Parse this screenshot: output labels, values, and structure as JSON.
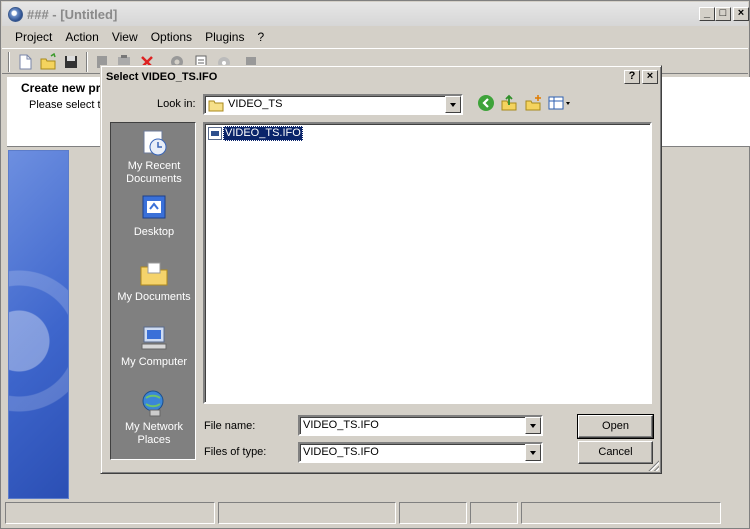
{
  "window": {
    "title": "### - [Untitled]",
    "controls": [
      "_",
      "□",
      "×"
    ]
  },
  "menu": [
    "Project",
    "Action",
    "View",
    "Options",
    "Plugins",
    "?"
  ],
  "header": {
    "title": "Create new pr",
    "subtitle": "Please select t"
  },
  "dialog": {
    "title": "Select VIDEO_TS.IFO",
    "help_label": "?",
    "close_label": "×",
    "look_in_label": "Look in:",
    "look_in_value": "VIDEO_TS",
    "places": [
      {
        "label": "My Recent Documents",
        "icon": "recent-documents-icon"
      },
      {
        "label": "Desktop",
        "icon": "desktop-icon"
      },
      {
        "label": "My Documents",
        "icon": "my-documents-icon"
      },
      {
        "label": "My Computer",
        "icon": "my-computer-icon"
      },
      {
        "label": "My Network Places",
        "icon": "network-places-icon"
      }
    ],
    "files": [
      {
        "name": "VIDEO_TS.IFO",
        "selected": true
      }
    ],
    "file_name_label": "File name:",
    "file_name_value": "VIDEO_TS.IFO",
    "file_type_label": "Files of type:",
    "file_type_value": "VIDEO_TS.IFO",
    "open_label": "Open",
    "cancel_label": "Cancel"
  }
}
